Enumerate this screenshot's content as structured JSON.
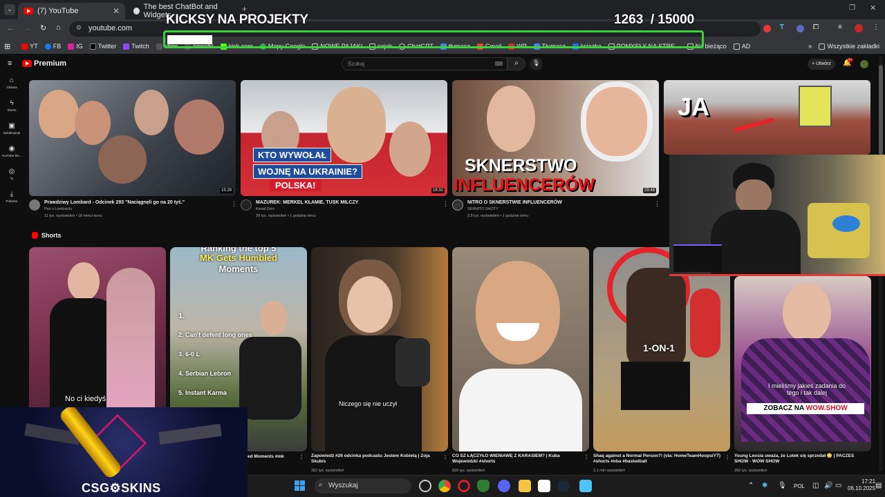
{
  "browser": {
    "tabs": [
      {
        "label": "(7) YouTube"
      },
      {
        "label": "The best ChatBot and Widgets"
      }
    ],
    "url": "youtube.com",
    "bookmarks": [
      "YT",
      "FB",
      "IG",
      "Twitter",
      "Twitch",
      "strim",
      "kowalki",
      "kick.com",
      "Mapy Google",
      "NOWE PAJAKI",
      "sejak",
      "ChatGPT",
      "tłumacz",
      "Gmail",
      "WP",
      "Tłumacz",
      "ksiazka",
      "POMYSŁY NA STRE...",
      "Na bieżąco",
      "AD"
    ],
    "all_bookmarks": "Wszystkie zakładki"
  },
  "overlay": {
    "title": "KICKSY NA PROJEKTY",
    "current": "1263",
    "goal": "/ 15000",
    "progress": 0.0842,
    "bar_color": "#3bd33b"
  },
  "youtube": {
    "logo": "Premium",
    "search_placeholder": "Szukaj",
    "create_label": "Utwórz",
    "notif_count": "9+",
    "sidebar": [
      "Główna",
      "Shorts",
      "Subskrypcje",
      "YouTube Mu...",
      "Ty",
      "Pobrane"
    ],
    "videos": [
      {
        "title": "Prawdziwy Lombard - Odcinek 293 \"Naciągnęli go na 20 tyś.\"",
        "channel": "Pan z Lombardu",
        "meta": "11 tys. wyświetleń • 18 minut temu",
        "duration": "15:29"
      },
      {
        "title": "MAZUREK: MERKEL KŁAMIE, TUSK MILCZY",
        "channel": "Kanał Zero",
        "meta": "28 tys. wyświetleń • 1 godzinę temu",
        "duration": "16:32",
        "overlay1": "KTO WYWOŁAŁ",
        "overlay2": "WOJNĘ NA UKRAINIE?",
        "overlay3": "POLSKA!"
      },
      {
        "title": "NITRO O SKNERSTWIE INFLUENCERÓW",
        "channel": "SERHITO SHOTY",
        "meta": "2,9 tys. wyświetleń • 1 godzinę temu",
        "duration": "29:48",
        "overlay1": "SKNERSTWO",
        "overlay2": "INFLUENCERÓW"
      },
      {
        "title": "",
        "channel": "",
        "meta": "",
        "duration": "",
        "overlay1": "JA"
      }
    ],
    "shorts_label": "Shorts",
    "shorts": [
      {
        "title": "",
        "meta": "",
        "caption": "No  ci kiedyś"
      },
      {
        "title": "ed Moments #mk",
        "meta": "",
        "caption_lines": [
          "Ranking the top 5",
          "MK Gets Humbled",
          "Moments"
        ],
        "list": [
          "1.",
          "2. Can't defent long ones",
          "3. 6-0 L",
          "4. Serbian Lebron",
          "5. Instant Karma"
        ]
      },
      {
        "title": "Zapowiedź #26 odcinka podcastu Jestem Kobietą | Zoja Skubis",
        "meta": "382 tys. wyświetleń",
        "caption": "Niczego się nie uczył"
      },
      {
        "title": "CO SZ ŁĄCZYŁO WIENIAWĘ Z KARASIEM? | Kuba Wojewódzki #shorts",
        "meta": "829 tys. wyświetleń",
        "caption": ""
      },
      {
        "title": "Shaq against a Normal Person?! (via: HomeTeamHoops/YT) #shorts #nba #basketball",
        "meta": "2,1 mln wyświetleń",
        "caption": "1-ON-1"
      },
      {
        "title": "Young Leosia uważa, że Lotek się sprzedał 😳 | PACZES SHOW - WOW SHOW",
        "meta": "250 tys. wyświetleń",
        "caption": "I mieliśmy jakieś zadania do tego i tak dalej",
        "banner": "ZOBACZ NA",
        "banner_brand": "WOW.SHOW"
      }
    ]
  },
  "ad": {
    "brand": "CSG⚙SKINS"
  },
  "taskbar": {
    "search": "Wyszukaj",
    "lang": "POL",
    "time": "17:21",
    "date": "06.10.2025"
  }
}
